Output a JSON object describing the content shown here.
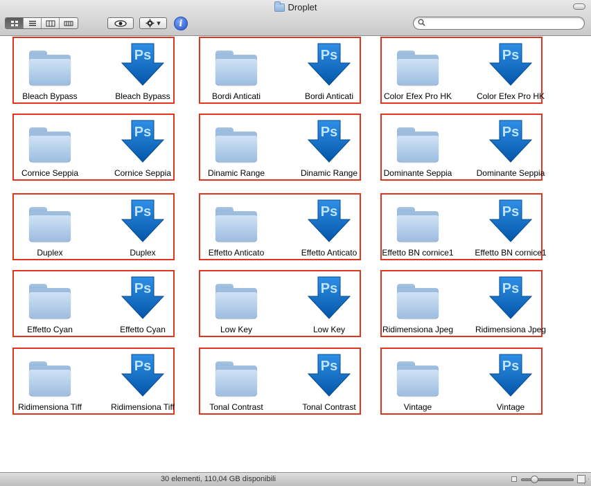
{
  "window": {
    "title": "Droplet"
  },
  "toolbar": {
    "view_modes": [
      "icon-view",
      "list-view",
      "column-view",
      "coverflow-view"
    ],
    "quicklook_icon": "eye-icon",
    "action_icon": "gear-icon",
    "info_icon": "info-icon",
    "info_glyph": "i",
    "search_placeholder": ""
  },
  "groups": [
    {
      "folder": "Bleach Bypass",
      "droplet": "Bleach Bypass"
    },
    {
      "folder": "Bordi Anticati",
      "droplet": "Bordi Anticati"
    },
    {
      "folder": "Color Efex Pro HK",
      "droplet": "Color Efex Pro HK"
    },
    {
      "folder": "Cornice Seppia",
      "droplet": "Cornice Seppia"
    },
    {
      "folder": "Dinamic Range",
      "droplet": "Dinamic Range"
    },
    {
      "folder": "Dominante Seppia",
      "droplet": "Dominante Seppia"
    },
    {
      "folder": "Duplex",
      "droplet": "Duplex"
    },
    {
      "folder": "Effetto Anticato",
      "droplet": "Effetto Anticato"
    },
    {
      "folder": "Effetto BN cornice1",
      "droplet": "Effetto BN cornice1"
    },
    {
      "folder": "Effetto Cyan",
      "droplet": "Effetto Cyan"
    },
    {
      "folder": "Low Key",
      "droplet": "Low Key"
    },
    {
      "folder": "Ridimensiona Jpeg",
      "droplet": "Ridimensiona Jpeg"
    },
    {
      "folder": "Ridimensiona Tiff",
      "droplet": "Ridimensiona Tiff"
    },
    {
      "folder": "Tonal Contrast",
      "droplet": "Tonal Contrast"
    },
    {
      "folder": "Vintage",
      "droplet": "Vintage"
    }
  ],
  "droplet_badge": "Ps",
  "colors": {
    "highlight_border": "#e2331d",
    "ps_arrow": "#0a6bc4"
  },
  "status": {
    "text": "30 elementi, 110,04 GB disponibili",
    "zoom_fraction": 0.2
  }
}
